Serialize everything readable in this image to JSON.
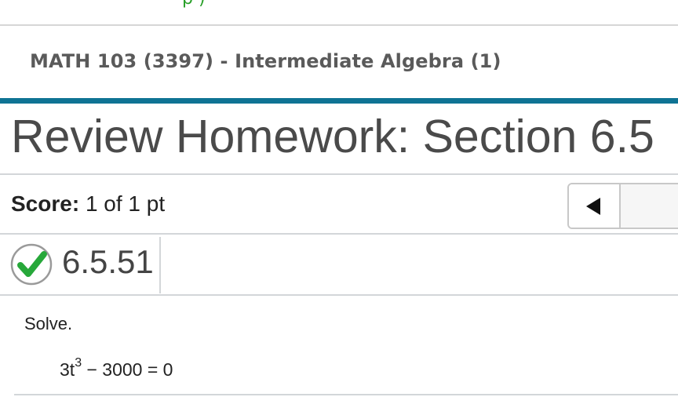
{
  "course": {
    "title": "MATH 103 (3397) - Intermediate Algebra (1)"
  },
  "page": {
    "title": "Review Homework: Section 6.5"
  },
  "score": {
    "label": "Score:",
    "value": "1 of 1 pt"
  },
  "navigation": {
    "prev_icon": "triangle-left-icon"
  },
  "problem": {
    "status_icon": "check-circle-icon",
    "status_color": "#27a83a",
    "id": "6.5.51",
    "instruction": "Solve.",
    "equation": {
      "left": "3t",
      "exponent": "3",
      "right": " − 3000 = 0"
    }
  },
  "colors": {
    "accent": "#0f7394",
    "divider": "#d3d6d9"
  }
}
